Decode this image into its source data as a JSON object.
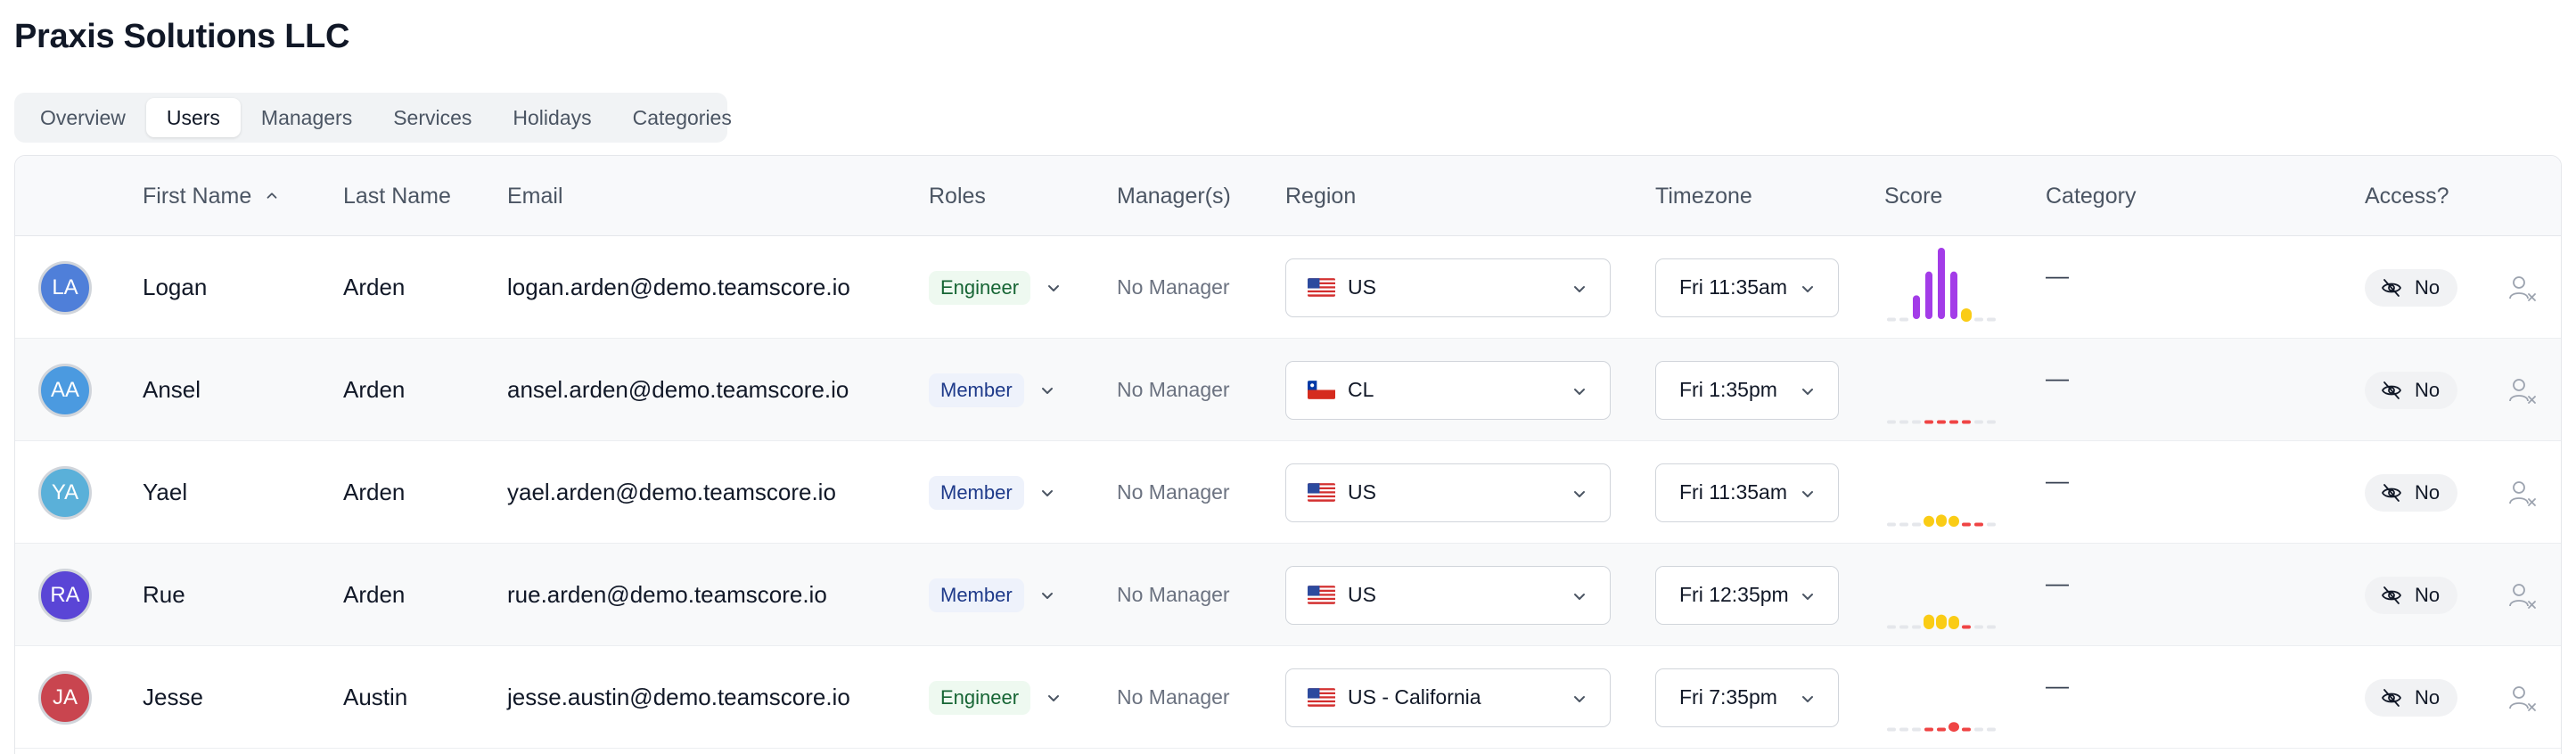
{
  "page_title": "Praxis Solutions LLC",
  "tabs": [
    {
      "label": "Overview",
      "active": false
    },
    {
      "label": "Users",
      "active": true
    },
    {
      "label": "Managers",
      "active": false
    },
    {
      "label": "Services",
      "active": false
    },
    {
      "label": "Holidays",
      "active": false
    },
    {
      "label": "Categories",
      "active": false
    }
  ],
  "columns": {
    "first_name": "First Name",
    "last_name": "Last Name",
    "email": "Email",
    "roles": "Roles",
    "managers": "Manager(s)",
    "region": "Region",
    "timezone": "Timezone",
    "score": "Score",
    "category": "Category",
    "access": "Access?"
  },
  "sort": {
    "column": "first_name",
    "direction": "ascending",
    "icon": "chevron-up-icon"
  },
  "rows": [
    {
      "initials": "LA",
      "avatar_color": "#4f7fd9",
      "first_name": "Logan",
      "last_name": "Arden",
      "email": "logan.arden@demo.teamscore.io",
      "role": "Engineer",
      "manager": "No Manager",
      "region": "US",
      "flag": "us-flag-icon",
      "timezone": "Fri 11:35am",
      "score": [
        0,
        0,
        1,
        2,
        3,
        2,
        0.5,
        0,
        0
      ],
      "score_colors": [
        "#e5e7eb",
        "#e5e7eb",
        "#a33ce8",
        "#a33ce8",
        "#a33ce8",
        "#a33ce8",
        "#facc15",
        "#e5e7eb",
        "#e5e7eb"
      ],
      "category": "—",
      "access": "No"
    },
    {
      "initials": "AA",
      "avatar_color": "#4b9ae0",
      "first_name": "Ansel",
      "last_name": "Arden",
      "email": "ansel.arden@demo.teamscore.io",
      "role": "Member",
      "manager": "No Manager",
      "region": "CL",
      "flag": "chile-flag-icon",
      "timezone": "Fri 1:35pm",
      "score": [
        0,
        0,
        0,
        0,
        0,
        0,
        0,
        0,
        0
      ],
      "score_colors": [
        "#e5e7eb",
        "#e5e7eb",
        "#e5e7eb",
        "#ef4444",
        "#ef4444",
        "#ef4444",
        "#ef4444",
        "#e5e7eb",
        "#e5e7eb"
      ],
      "category": "—",
      "access": "No"
    },
    {
      "initials": "YA",
      "avatar_color": "#5ab0d9",
      "first_name": "Yael",
      "last_name": "Arden",
      "email": "yael.arden@demo.teamscore.io",
      "role": "Member",
      "manager": "No Manager",
      "region": "US",
      "flag": "us-flag-icon",
      "timezone": "Fri 11:35am",
      "score": [
        0,
        0,
        0,
        0.3,
        0.4,
        0.3,
        0,
        0,
        0
      ],
      "score_colors": [
        "#e5e7eb",
        "#e5e7eb",
        "#e5e7eb",
        "#facc15",
        "#facc15",
        "#facc15",
        "#ef4444",
        "#ef4444",
        "#e5e7eb"
      ],
      "category": "—",
      "access": "No"
    },
    {
      "initials": "RA",
      "avatar_color": "#5a45d6",
      "first_name": "Rue",
      "last_name": "Arden",
      "email": "rue.arden@demo.teamscore.io",
      "role": "Member",
      "manager": "No Manager",
      "region": "US",
      "flag": "us-flag-icon",
      "timezone": "Fri 12:35pm",
      "score": [
        0,
        0,
        0,
        0.6,
        0.6,
        0.5,
        0,
        0,
        0
      ],
      "score_colors": [
        "#e5e7eb",
        "#e5e7eb",
        "#e5e7eb",
        "#facc15",
        "#facc15",
        "#facc15",
        "#ef4444",
        "#e5e7eb",
        "#e5e7eb"
      ],
      "category": "—",
      "access": "No"
    },
    {
      "initials": "JA",
      "avatar_color": "#c9454f",
      "first_name": "Jesse",
      "last_name": "Austin",
      "email": "jesse.austin@demo.teamscore.io",
      "role": "Engineer",
      "manager": "No Manager",
      "region": "US - California",
      "flag": "us-flag-icon",
      "timezone": "Fri 7:35pm",
      "score": [
        0,
        0,
        0,
        0,
        0,
        0.2,
        0,
        0,
        0
      ],
      "score_colors": [
        "#e5e7eb",
        "#e5e7eb",
        "#e5e7eb",
        "#ef4444",
        "#ef4444",
        "#ef4444",
        "#ef4444",
        "#e5e7eb",
        "#e5e7eb"
      ],
      "category": "—",
      "access": "No"
    }
  ]
}
